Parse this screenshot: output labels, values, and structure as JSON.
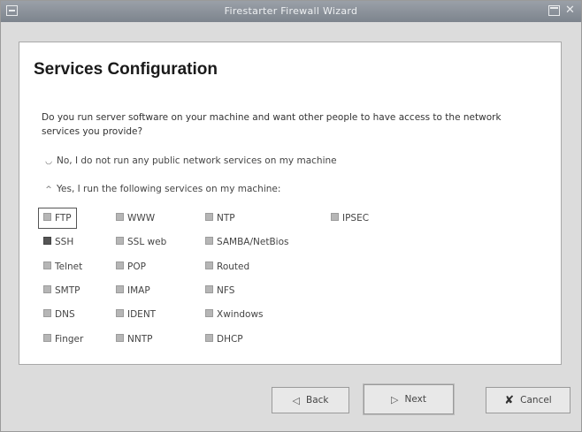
{
  "window": {
    "title": "Firestarter Firewall Wizard"
  },
  "page": {
    "heading": "Services Configuration",
    "question": "Do you run server software on your machine and want other people to have access to the network services you provide?",
    "options": {
      "no": "No, I do not run any public network services on my machine",
      "yes": "Yes, I run the following services on my machine:"
    },
    "selected_option": "yes"
  },
  "services": {
    "ftp": {
      "label": "FTP",
      "checked": false
    },
    "www": {
      "label": "WWW",
      "checked": false
    },
    "ntp": {
      "label": "NTP",
      "checked": false
    },
    "ipsec": {
      "label": "IPSEC",
      "checked": false
    },
    "ssh": {
      "label": "SSH",
      "checked": true
    },
    "ssl_web": {
      "label": "SSL web",
      "checked": false
    },
    "samba": {
      "label": "SAMBA/NetBios",
      "checked": false
    },
    "telnet": {
      "label": "Telnet",
      "checked": false
    },
    "pop": {
      "label": "POP",
      "checked": false
    },
    "routed": {
      "label": "Routed",
      "checked": false
    },
    "smtp": {
      "label": "SMTP",
      "checked": false
    },
    "imap": {
      "label": "IMAP",
      "checked": false
    },
    "nfs": {
      "label": "NFS",
      "checked": false
    },
    "dns": {
      "label": "DNS",
      "checked": false
    },
    "ident": {
      "label": "IDENT",
      "checked": false
    },
    "xwindows": {
      "label": "Xwindows",
      "checked": false
    },
    "finger": {
      "label": "Finger",
      "checked": false
    },
    "nntp": {
      "label": "NNTP",
      "checked": false
    },
    "dhcp": {
      "label": "DHCP",
      "checked": false
    }
  },
  "buttons": {
    "back": "Back",
    "next": "Next",
    "cancel": "Cancel"
  }
}
